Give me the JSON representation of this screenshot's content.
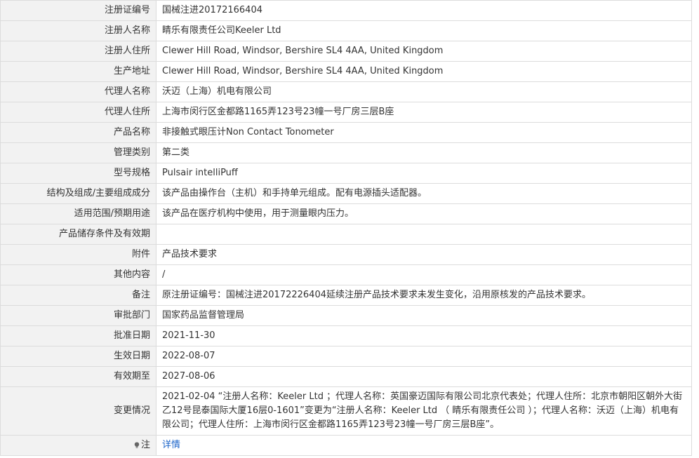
{
  "rows": [
    {
      "label": "注册证编号",
      "value": "国械注进20172166404"
    },
    {
      "label": "注册人名称",
      "value": "睛乐有限责任公司Keeler Ltd"
    },
    {
      "label": "注册人住所",
      "value": "Clewer Hill Road, Windsor, Bershire SL4 4AA, United Kingdom"
    },
    {
      "label": "生产地址",
      "value": "Clewer Hill Road, Windsor, Bershire SL4 4AA, United Kingdom"
    },
    {
      "label": "代理人名称",
      "value": "沃迈（上海）机电有限公司"
    },
    {
      "label": "代理人住所",
      "value": "上海市闵行区金都路1165弄123号23幢一号厂房三层B座"
    },
    {
      "label": "产品名称",
      "value": "非接触式眼压计Non Contact Tonometer"
    },
    {
      "label": "管理类别",
      "value": "第二类"
    },
    {
      "label": "型号规格",
      "value": "Pulsair intelliPuff"
    },
    {
      "label": "结构及组成/主要组成成分",
      "value": "该产品由操作台（主机）和手持单元组成。配有电源插头适配器。"
    },
    {
      "label": "适用范围/预期用途",
      "value": "该产品在医疗机构中使用，用于测量眼内压力。"
    },
    {
      "label": "产品储存条件及有效期",
      "value": ""
    },
    {
      "label": "附件",
      "value": "产品技术要求"
    },
    {
      "label": "其他内容",
      "value": "/"
    },
    {
      "label": "备注",
      "value": "原注册证编号：国械注进20172226404延续注册产品技术要求未发生变化，沿用原核发的产品技术要求。"
    },
    {
      "label": "审批部门",
      "value": "国家药品监督管理局"
    },
    {
      "label": "批准日期",
      "value": "2021-11-30"
    },
    {
      "label": "生效日期",
      "value": "2022-08-07"
    },
    {
      "label": "有效期至",
      "value": "2027-08-06"
    },
    {
      "label": "变更情况",
      "value": "2021-02-04 “注册人名称：Keeler Ltd ；代理人名称：英国豪迈国际有限公司北京代表处；代理人住所：北京市朝阳区朝外大街乙12号昆泰国际大厦16层0-1601”变更为“注册人名称：Keeler Ltd （ 睛乐有限责任公司 ）；代理人名称：沃迈（上海）机电有限公司；代理人住所：上海市闵行区金都路1165弄123号23幢一号厂房三层B座”。"
    }
  ],
  "note": {
    "label": "注",
    "icon": "note-icon",
    "link_text": "详情"
  }
}
